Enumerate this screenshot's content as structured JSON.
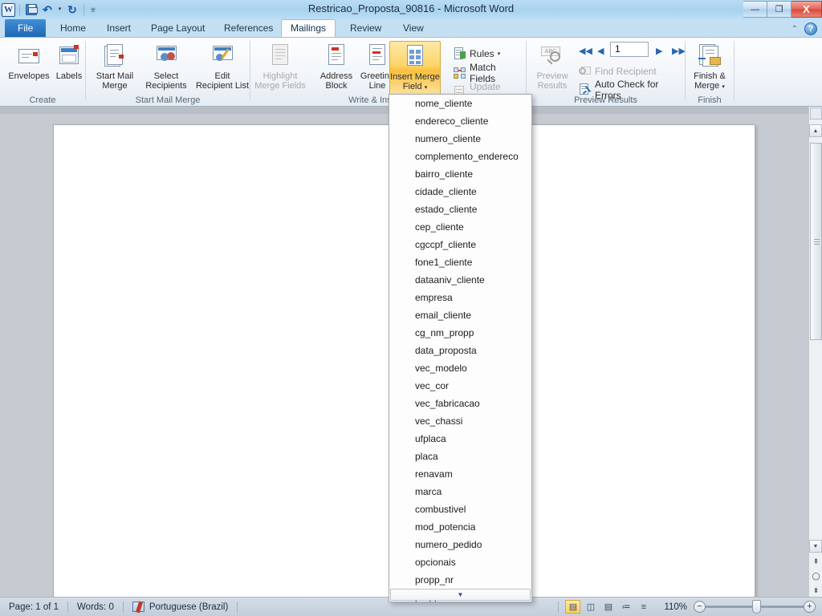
{
  "window": {
    "title": "Restricao_Proposta_90816 - Microsoft Word",
    "minimize_label": "—",
    "restore_label": "❐",
    "close_label": "X",
    "help_label": "?",
    "collapse_label": "⌃"
  },
  "quick_access": {
    "logo": "W",
    "items": [
      {
        "name": "save-icon",
        "label": ""
      },
      {
        "name": "undo-icon",
        "label": "↶"
      },
      {
        "name": "undo-dropdown-icon",
        "label": "▾"
      },
      {
        "name": "redo-icon",
        "label": "↻"
      },
      {
        "name": "customize-qat-icon",
        "label": "⩸"
      }
    ]
  },
  "tabs": [
    {
      "label": "File",
      "active": false,
      "file": true
    },
    {
      "label": "Home",
      "active": false
    },
    {
      "label": "Insert",
      "active": false
    },
    {
      "label": "Page Layout",
      "active": false
    },
    {
      "label": "References",
      "active": false
    },
    {
      "label": "Mailings",
      "active": true
    },
    {
      "label": "Review",
      "active": false
    },
    {
      "label": "View",
      "active": false
    }
  ],
  "ribbon": {
    "groups": [
      {
        "label": "Create"
      },
      {
        "label": "Start Mail Merge"
      },
      {
        "label": "Write & Insert Fields"
      },
      {
        "label": "Preview Results"
      },
      {
        "label": "Finish"
      }
    ],
    "create": {
      "envelopes": "Envelopes",
      "labels": "Labels"
    },
    "start_mail_merge": {
      "start_mail_merge_l1": "Start Mail",
      "start_mail_merge_l2": "Merge",
      "select_recipients_l1": "Select",
      "select_recipients_l2": "Recipients",
      "edit_recipient_l1": "Edit",
      "edit_recipient_l2": "Recipient List"
    },
    "write_insert": {
      "highlight_l1": "Highlight",
      "highlight_l2": "Merge Fields",
      "address_block_l1": "Address",
      "address_block_l2": "Block",
      "greeting_line_l1": "Greeting",
      "greeting_line_l2": "Line",
      "insert_merge_field_l1": "Insert Merge",
      "insert_merge_field_l2": "Field",
      "rules": "Rules",
      "match_fields": "Match Fields",
      "update_labels": "Update Labels"
    },
    "preview": {
      "preview_results_l1": "Preview",
      "preview_results_l2": "Results",
      "record_number": "1",
      "find_recipient": "Find Recipient",
      "auto_check": "Auto Check for Errors",
      "first_record": "◀◀",
      "prev_record": "◀",
      "next_record": "▶",
      "last_record": "▶▶"
    },
    "finish": {
      "finish_merge_l1": "Finish &",
      "finish_merge_l2": "Merge"
    }
  },
  "insert_merge_field_menu": {
    "items": [
      "nome_cliente",
      "endereco_cliente",
      "numero_cliente",
      "complemento_endereco",
      "bairro_cliente",
      "cidade_cliente",
      "estado_cliente",
      "cep_cliente",
      "cgccpf_cliente",
      "fone1_cliente",
      "dataaniv_cliente",
      "empresa",
      "email_cliente",
      "cg_nm_propp",
      "data_proposta",
      "vec_modelo",
      "vec_cor",
      "vec_fabricacao",
      "vec_chassi",
      "ufplaca",
      "placa",
      "renavam",
      "marca",
      "combustivel",
      "mod_potencia",
      "numero_pedido",
      "opcionais",
      "propp_nr",
      "propp_dtvenc"
    ],
    "scroll_down_label": "▼"
  },
  "status_bar": {
    "page": "Page: 1 of 1",
    "words": "Words: 0",
    "language": "Portuguese (Brazil)",
    "zoom": "110%",
    "zoom_out_label": "−",
    "zoom_in_label": "+",
    "view_buttons": [
      {
        "name": "print-layout-view",
        "glyph": "▤",
        "selected": true
      },
      {
        "name": "full-screen-reading-view",
        "glyph": "◫",
        "selected": false
      },
      {
        "name": "web-layout-view",
        "glyph": "▤",
        "selected": false
      },
      {
        "name": "outline-view",
        "glyph": "≔",
        "selected": false
      },
      {
        "name": "draft-view",
        "glyph": "≡",
        "selected": false
      }
    ]
  },
  "scrollbar": {
    "up_label": "▲",
    "down_label": "▼",
    "previous_page_label": "⇞",
    "select_browse_object_label": "◯",
    "next_page_label": "⇟"
  },
  "colors": {
    "accent": "#1e68b5",
    "active_button": "#f9c03e",
    "title_bar": "#a9d2ee",
    "close_button": "#d8493e"
  }
}
